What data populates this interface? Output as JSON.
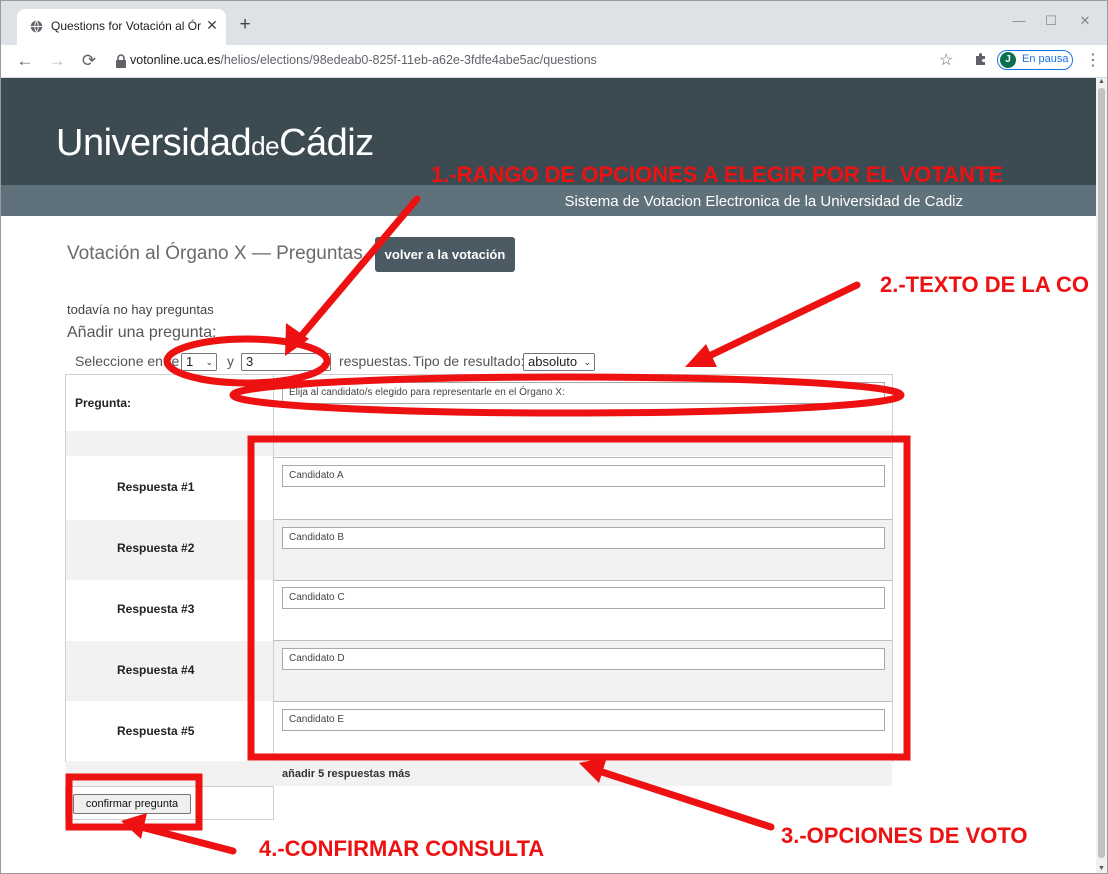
{
  "browser": {
    "tab_title": "Questions for Votación al Órgan",
    "url_host": "votonline.uca.es",
    "url_path": "/helios/elections/98edeab0-825f-11eb-a62e-3fdfe4abe5ac/questions",
    "profile_initial": "J",
    "profile_label": "En pausa",
    "accent_color": "#1a73e8"
  },
  "site": {
    "logo_part1": "Universidad",
    "logo_part2": "de",
    "logo_part3": "Cádiz",
    "subtitle": "Sistema de Votacion Electronica de la Universidad de Cadiz",
    "header_color": "#3c4b52",
    "subbar_color": "#5f717a"
  },
  "page": {
    "title": "Votación al Órgano X — Preguntas",
    "back_button": "volver a la votación",
    "no_questions": "todavía no hay preguntas",
    "add_question": "Añadir una pregunta:",
    "range_prefix": "Seleccione entre",
    "range_y": "y",
    "range_suffix": "respuestas.",
    "min_value": "1",
    "max_value": "3",
    "result_type_label": "Tipo de resultado:",
    "result_type_value": "absoluto"
  },
  "question": {
    "label": "Pregunta:",
    "text": "Elija al candidato/s elegido para representarle en el Órgano X:"
  },
  "answers": [
    {
      "label": "Respuesta #1",
      "value": "Candidato A"
    },
    {
      "label": "Respuesta #2",
      "value": "Candidato B"
    },
    {
      "label": "Respuesta #3",
      "value": "Candidato C"
    },
    {
      "label": "Respuesta #4",
      "value": "Candidato D"
    },
    {
      "label": "Respuesta #5",
      "value": "Candidato E"
    }
  ],
  "add_more": "añadir 5 respuestas más",
  "confirm_button": "confirmar pregunta",
  "annotations": {
    "a1": "1.-RANGO DE OPCIONES A ELEGIR POR EL VOTANTE",
    "a2": "2.-TEXTO DE LA CO",
    "a3": "3.-OPCIONES DE VOTO",
    "a4": "4.-CONFIRMAR CONSULTA",
    "color": "#ee1111"
  }
}
